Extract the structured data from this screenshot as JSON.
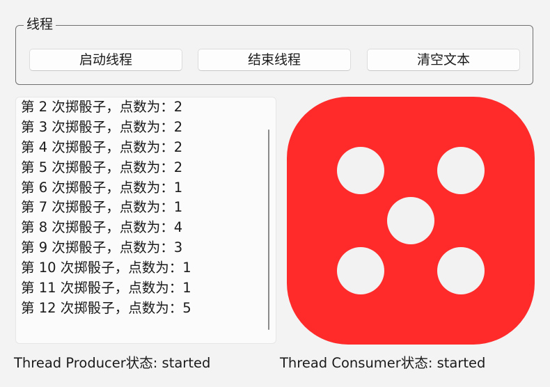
{
  "group": {
    "title": "线程",
    "buttons": {
      "start": "启动线程",
      "stop": "结束线程",
      "clear": "清空文本"
    }
  },
  "log": {
    "lines": [
      "第 2 次掷骰子，点数为：2",
      "第 3 次掷骰子，点数为：2",
      "第 4 次掷骰子，点数为：2",
      "第 5 次掷骰子，点数为：2",
      "第 6 次掷骰子，点数为：1",
      "第 7 次掷骰子，点数为：1",
      "第 8 次掷骰子，点数为：4",
      "第 9 次掷骰子，点数为：3",
      "第 10 次掷骰子，点数为：1",
      "第 11 次掷骰子，点数为：1",
      "第 12 次掷骰子，点数为：5"
    ]
  },
  "dice": {
    "face_value": 5,
    "color": "#ff2b2b",
    "pip_color": "#f2f2f2"
  },
  "status": {
    "producer": "Thread Producer状态: started",
    "consumer": "Thread Consumer状态: started"
  }
}
